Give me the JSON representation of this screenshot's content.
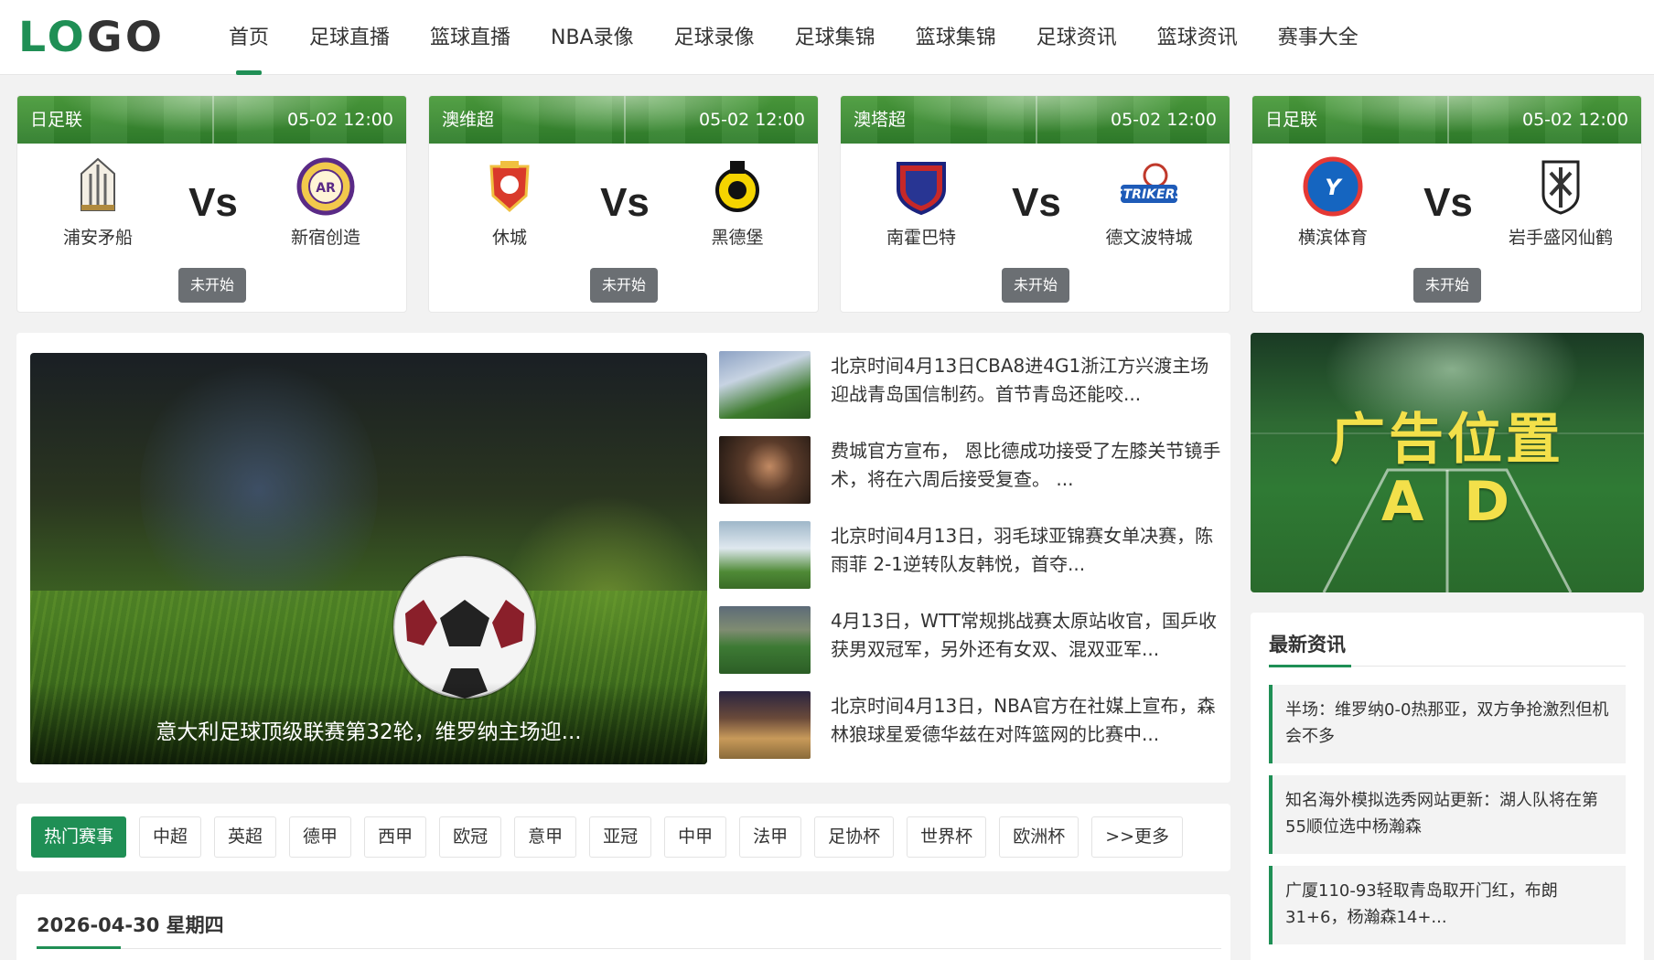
{
  "header": {
    "logo_text": "LOGO",
    "nav": [
      {
        "label": "首页",
        "active": true
      },
      {
        "label": "足球直播"
      },
      {
        "label": "篮球直播"
      },
      {
        "label": "NBA录像"
      },
      {
        "label": "足球录像"
      },
      {
        "label": "足球集锦"
      },
      {
        "label": "篮球集锦"
      },
      {
        "label": "足球资讯"
      },
      {
        "label": "篮球资讯"
      },
      {
        "label": "赛事大全"
      }
    ]
  },
  "matches": [
    {
      "league": "日足联",
      "time": "05-02 12:00",
      "home": "浦安矛船",
      "away": "新宿创造",
      "vs": "Vs",
      "status": "未开始"
    },
    {
      "league": "澳维超",
      "time": "05-02 12:00",
      "home": "休城",
      "away": "黑德堡",
      "vs": "Vs",
      "status": "未开始"
    },
    {
      "league": "澳塔超",
      "time": "05-02 12:00",
      "home": "南霍巴特",
      "away": "德文波特城",
      "vs": "Vs",
      "status": "未开始"
    },
    {
      "league": "日足联",
      "time": "05-02 12:00",
      "home": "横滨体育",
      "away": "岩手盛冈仙鹤",
      "vs": "Vs",
      "status": "未开始"
    }
  ],
  "hero": {
    "caption": "意大利足球顶级联赛第32轮，维罗纳主场迎..."
  },
  "news": [
    {
      "title": "北京时间4月13日CBA8进4G1浙江方兴渡主场迎战青岛国信制药。首节青岛还能咬..."
    },
    {
      "title": "费城官方宣布， 恩比德成功接受了左膝关节镜手术，将在六周后接受复查。 ..."
    },
    {
      "title": "北京时间4月13日，羽毛球亚锦赛女单决赛，陈雨菲 2-1逆转队友韩悦，首夺..."
    },
    {
      "title": "4月13日，WTT常规挑战赛太原站收官，国乒收获男双冠军，另外还有女双、混双亚军..."
    },
    {
      "title": "北京时间4月13日，NBA官方在社媒上宣布，森林狼球星爱德华兹在对阵篮网的比赛中..."
    }
  ],
  "tags": [
    {
      "label": "热门赛事",
      "active": true
    },
    {
      "label": "中超"
    },
    {
      "label": "英超"
    },
    {
      "label": "德甲"
    },
    {
      "label": "西甲"
    },
    {
      "label": "欧冠"
    },
    {
      "label": "意甲"
    },
    {
      "label": "亚冠"
    },
    {
      "label": "中甲"
    },
    {
      "label": "法甲"
    },
    {
      "label": "足协杯"
    },
    {
      "label": "世界杯"
    },
    {
      "label": "欧洲杯"
    },
    {
      "label": ">>更多"
    }
  ],
  "schedule": {
    "date": "2026-04-30 星期四"
  },
  "ad": {
    "title": "广告位置",
    "sub": "AD"
  },
  "sidebar": {
    "title": "最新资讯",
    "items": [
      {
        "text": "半场：维罗纳0-0热那亚，双方争抢激烈但机会不多"
      },
      {
        "text": "知名海外模拟选秀网站更新：湖人队将在第55顺位选中杨瀚森"
      },
      {
        "text": "广厦110-93轻取青岛取开门红，布朗31+6，杨瀚森14+..."
      }
    ]
  },
  "colors": {
    "accent": "#1f8f55",
    "status_button": "#6b6f73"
  }
}
